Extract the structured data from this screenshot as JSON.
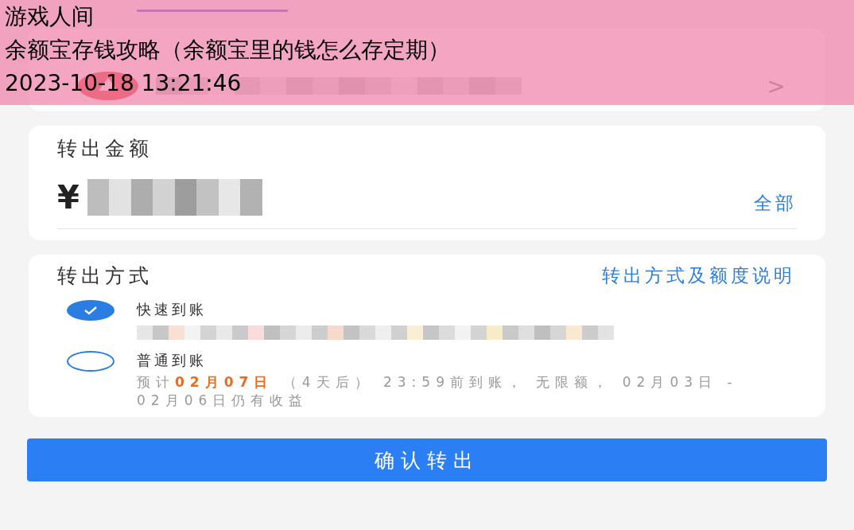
{
  "overlay": {
    "lines": [
      "游戏人间",
      "余额宝存钱攻略（余额宝里的钱怎么存定期）",
      "2023-10-18 13:21:46"
    ]
  },
  "account_card": {
    "chevron": ">"
  },
  "amount": {
    "label": "转出金额",
    "currency": "¥",
    "all_link": "全部"
  },
  "method": {
    "title": "转出方式",
    "help_link": "转出方式及额度说明",
    "options": [
      {
        "label": "快速到账",
        "selected": true,
        "kind": "redacted"
      },
      {
        "label": "普通到账",
        "selected": false,
        "kind": "text",
        "detail": [
          {
            "text": "预计",
            "highlight": false
          },
          {
            "text": "02月07日",
            "highlight": true
          },
          {
            "text": " （4天后） 23:59前到账， 无限额， 02月03日 - 02月06日仍有收益",
            "highlight": false
          }
        ]
      }
    ]
  },
  "confirm_button": "确认转出"
}
